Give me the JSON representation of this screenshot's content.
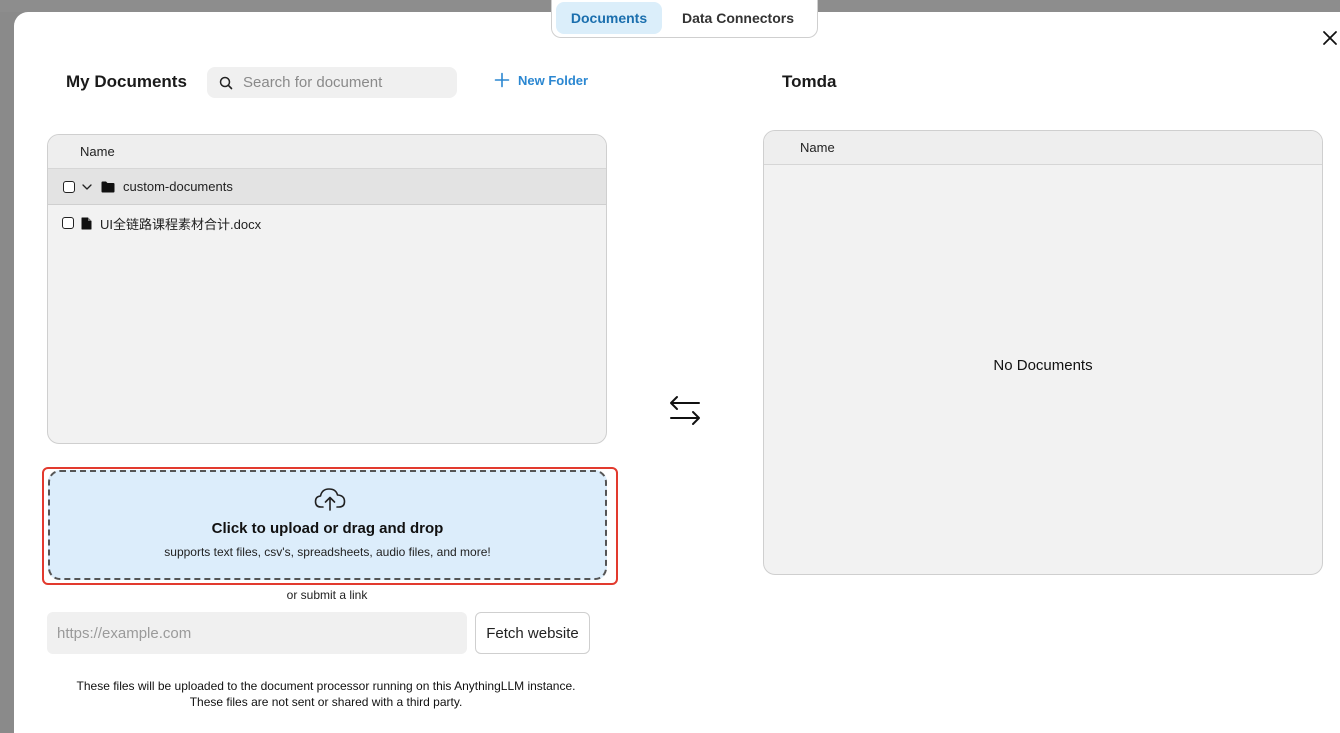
{
  "tabs": [
    {
      "label": "Documents",
      "active": true
    },
    {
      "label": "Data Connectors",
      "active": false
    }
  ],
  "left": {
    "title": "My Documents",
    "search_placeholder": "Search for document",
    "new_folder_label": "New Folder",
    "header_name": "Name",
    "rows": [
      {
        "type": "folder",
        "name": "custom-documents",
        "expanded": true
      },
      {
        "type": "file",
        "name": "UI全链路课程素材合计.docx"
      }
    ]
  },
  "right": {
    "title": "Tomda",
    "header_name": "Name",
    "empty_message": "No Documents"
  },
  "upload": {
    "title": "Click to upload or drag and drop",
    "subtitle": "supports text files, csv's, spreadsheets, audio files, and more!",
    "or_link": "or submit a link",
    "url_placeholder": "https://example.com",
    "fetch_label": "Fetch website"
  },
  "footer": {
    "line1": "These files will be uploaded to the document processor running on this AnythingLLM instance.",
    "line2": "These files are not sent or shared with a third party."
  },
  "colors": {
    "accent": "#2b87d1",
    "active_tab_bg": "#dbeefa",
    "upload_bg": "#dcedfb",
    "highlight_outline": "#e23a2e"
  },
  "icons": {
    "search": "search-icon",
    "new_folder": "plus-icon",
    "close": "close-icon",
    "swap": "swap-arrows-icon",
    "upload": "cloud-upload-icon",
    "folder": "folder-icon",
    "file": "file-icon",
    "chevron": "chevron-down-icon"
  }
}
